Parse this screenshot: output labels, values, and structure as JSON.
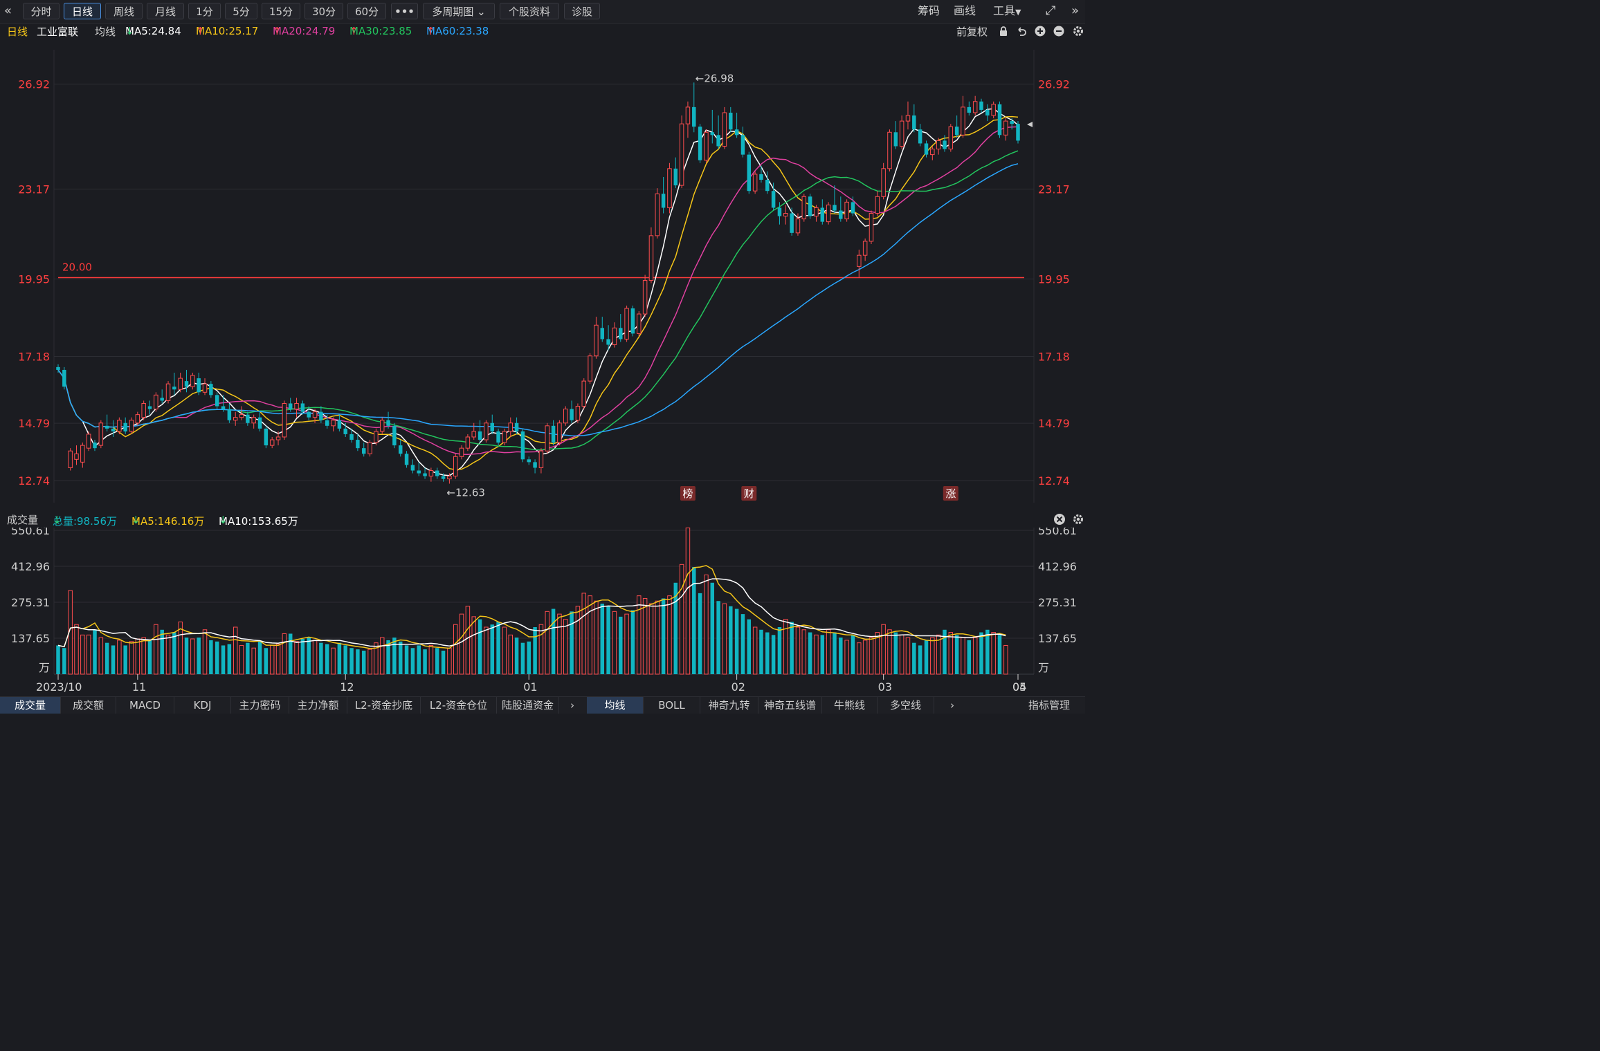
{
  "toolbar": {
    "back_icon": "double-chevron-left-icon",
    "periods": [
      "分时",
      "日线",
      "周线",
      "月线",
      "1分",
      "5分",
      "15分",
      "30分",
      "60分"
    ],
    "active_period": "日线",
    "more_label": "•••",
    "multi_period_label": "多周期图",
    "stock_info_label": "个股资料",
    "diagnose_label": "诊股",
    "right_items": [
      "筹码",
      "画线",
      "工具"
    ],
    "expand_icon": "expand-icon",
    "collapse_icon": "double-chevron-right-icon"
  },
  "price_header": {
    "period": "日线",
    "stock_name": "工业富联",
    "ma_label": "均线",
    "ma": [
      {
        "label": "MA5:24.84",
        "arrow": "↓",
        "color": "#ffffff",
        "arrow_color": "#2ecc71"
      },
      {
        "label": "MA10:25.17",
        "arrow": "↑",
        "color": "#f5c518",
        "arrow_color": "#ff4d4f"
      },
      {
        "label": "MA20:24.79",
        "arrow": "↑",
        "color": "#e040a0",
        "arrow_color": "#ff4d4f"
      },
      {
        "label": "MA30:23.85",
        "arrow": "↑",
        "color": "#22c55e",
        "arrow_color": "#ff4d4f"
      },
      {
        "label": "MA60:23.38",
        "arrow": "↑",
        "color": "#2aa7ff",
        "arrow_color": "#ff4d4f"
      }
    ],
    "adjust_label": "前复权"
  },
  "volume_header": {
    "title": "成交量",
    "total": "总量:98.56万",
    "total_arrow": "↓",
    "ma5": "MA5:146.16万",
    "ma5_arrow": "↓",
    "ma10": "MA10:153.65万",
    "ma10_arrow": "↓"
  },
  "colors": {
    "up": "#ff4d4f",
    "down": "#11b5c2",
    "ma5": "#ffffff",
    "ma10": "#f5c518",
    "ma20": "#e040a0",
    "ma30": "#22c55e",
    "ma60": "#2aa7ff",
    "axis_text": "#ff4040",
    "grid": "#2c2d33"
  },
  "chart_data": [
    {
      "type": "candlestick",
      "ylim": [
        11.95,
        28.15
      ],
      "y_ticks": [
        "26.92",
        "23.17",
        "19.95",
        "17.18",
        "14.79",
        "12.74"
      ],
      "x_ticks": [
        "2023/10",
        "11",
        "12",
        "01",
        "02",
        "03",
        "04",
        "05"
      ],
      "reference_line": {
        "value": 20.0,
        "label": "20.00"
      },
      "annotations": [
        {
          "label": "←26.98",
          "value": 26.98
        },
        {
          "label": "←12.63",
          "value": 12.63
        }
      ],
      "event_markers": [
        "榜",
        "财",
        "涨"
      ],
      "ohlc": [
        [
          16.8,
          16.9,
          16.6,
          16.7
        ],
        [
          16.7,
          16.8,
          16.0,
          16.1
        ],
        [
          13.2,
          13.9,
          13.1,
          13.8
        ],
        [
          13.5,
          14.0,
          13.3,
          13.7
        ],
        [
          13.4,
          14.1,
          13.2,
          14.0
        ],
        [
          13.9,
          14.5,
          13.8,
          14.4
        ],
        [
          14.1,
          14.2,
          13.8,
          13.9
        ],
        [
          14.0,
          14.9,
          13.9,
          14.8
        ],
        [
          14.7,
          15.1,
          14.5,
          14.6
        ],
        [
          14.6,
          14.9,
          14.3,
          14.5
        ],
        [
          14.5,
          15.0,
          14.4,
          14.9
        ],
        [
          14.8,
          15.0,
          14.4,
          14.5
        ],
        [
          14.5,
          15.0,
          14.4,
          14.9
        ],
        [
          14.8,
          15.2,
          14.7,
          15.1
        ],
        [
          15.0,
          15.6,
          14.9,
          15.5
        ],
        [
          15.4,
          15.6,
          15.1,
          15.3
        ],
        [
          15.3,
          15.9,
          15.2,
          15.8
        ],
        [
          15.7,
          16.0,
          15.5,
          15.6
        ],
        [
          15.6,
          16.3,
          15.5,
          16.2
        ],
        [
          16.1,
          16.6,
          15.8,
          16.0
        ],
        [
          16.0,
          16.6,
          15.9,
          16.4
        ],
        [
          16.3,
          16.7,
          15.9,
          16.1
        ],
        [
          16.1,
          16.6,
          16.0,
          16.5
        ],
        [
          16.4,
          16.6,
          15.8,
          15.9
        ],
        [
          15.9,
          16.4,
          15.8,
          16.2
        ],
        [
          16.2,
          16.3,
          15.7,
          15.8
        ],
        [
          15.8,
          15.9,
          15.3,
          15.4
        ],
        [
          15.4,
          15.8,
          15.2,
          15.3
        ],
        [
          15.3,
          15.5,
          14.8,
          14.9
        ],
        [
          14.9,
          15.2,
          14.7,
          15.0
        ],
        [
          15.0,
          15.4,
          14.9,
          15.1
        ],
        [
          15.1,
          15.2,
          14.7,
          14.8
        ],
        [
          14.8,
          15.1,
          14.6,
          15.0
        ],
        [
          15.0,
          15.2,
          14.5,
          14.6
        ],
        [
          14.6,
          14.7,
          13.9,
          14.0
        ],
        [
          14.0,
          14.3,
          13.9,
          14.2
        ],
        [
          14.2,
          14.5,
          14.0,
          14.3
        ],
        [
          14.3,
          15.6,
          14.2,
          15.5
        ],
        [
          15.5,
          15.7,
          15.2,
          15.3
        ],
        [
          15.3,
          15.7,
          15.0,
          15.5
        ],
        [
          15.5,
          15.6,
          15.1,
          15.2
        ],
        [
          15.2,
          15.4,
          14.9,
          15.0
        ],
        [
          15.0,
          15.3,
          14.8,
          15.2
        ],
        [
          15.2,
          15.4,
          14.8,
          14.9
        ],
        [
          14.9,
          15.1,
          14.6,
          14.7
        ],
        [
          14.7,
          15.0,
          14.5,
          14.9
        ],
        [
          14.9,
          15.1,
          14.5,
          14.6
        ],
        [
          14.6,
          14.8,
          14.3,
          14.4
        ],
        [
          14.4,
          14.6,
          14.1,
          14.2
        ],
        [
          14.2,
          14.4,
          13.8,
          13.9
        ],
        [
          13.9,
          14.1,
          13.6,
          13.7
        ],
        [
          13.7,
          14.2,
          13.6,
          14.1
        ],
        [
          14.1,
          14.6,
          14.0,
          14.5
        ],
        [
          14.5,
          15.0,
          14.4,
          14.9
        ],
        [
          14.9,
          15.2,
          14.6,
          14.7
        ],
        [
          14.7,
          14.8,
          13.9,
          14.0
        ],
        [
          14.0,
          14.2,
          13.6,
          13.7
        ],
        [
          13.7,
          13.8,
          13.2,
          13.3
        ],
        [
          13.3,
          13.5,
          13.0,
          13.1
        ],
        [
          13.1,
          13.4,
          12.9,
          13.0
        ],
        [
          13.0,
          13.2,
          12.8,
          12.9
        ],
        [
          12.9,
          13.2,
          12.7,
          13.1
        ],
        [
          13.1,
          13.2,
          12.8,
          12.9
        ],
        [
          12.9,
          13.0,
          12.7,
          12.8
        ],
        [
          12.8,
          13.0,
          12.63,
          12.9
        ],
        [
          12.9,
          13.7,
          12.8,
          13.6
        ],
        [
          13.6,
          14.0,
          13.5,
          13.9
        ],
        [
          13.9,
          14.4,
          13.8,
          14.3
        ],
        [
          14.3,
          14.8,
          14.2,
          14.5
        ],
        [
          14.5,
          14.9,
          14.1,
          14.2
        ],
        [
          14.2,
          14.9,
          14.1,
          14.8
        ],
        [
          14.8,
          15.1,
          14.4,
          14.5
        ],
        [
          14.5,
          14.6,
          14.0,
          14.1
        ],
        [
          14.1,
          14.6,
          14.0,
          14.5
        ],
        [
          14.5,
          15.0,
          14.3,
          14.8
        ],
        [
          14.8,
          15.0,
          14.4,
          14.5
        ],
        [
          14.5,
          14.6,
          13.4,
          13.5
        ],
        [
          13.5,
          13.6,
          13.3,
          13.4
        ],
        [
          13.4,
          13.5,
          13.0,
          13.2
        ],
        [
          13.2,
          13.9,
          13.0,
          13.8
        ],
        [
          13.8,
          14.8,
          13.7,
          14.7
        ],
        [
          14.7,
          14.9,
          14.0,
          14.1
        ],
        [
          14.1,
          14.9,
          14.0,
          14.8
        ],
        [
          14.8,
          15.4,
          14.7,
          15.3
        ],
        [
          15.3,
          15.6,
          14.8,
          14.9
        ],
        [
          14.9,
          15.5,
          14.8,
          15.4
        ],
        [
          15.4,
          16.4,
          15.3,
          16.3
        ],
        [
          16.3,
          17.3,
          16.2,
          17.2
        ],
        [
          17.2,
          18.6,
          17.1,
          18.3
        ],
        [
          18.2,
          18.6,
          17.7,
          17.8
        ],
        [
          17.8,
          18.3,
          17.4,
          17.6
        ],
        [
          17.6,
          18.4,
          17.5,
          18.2
        ],
        [
          18.2,
          18.7,
          17.7,
          17.8
        ],
        [
          17.8,
          19.0,
          17.7,
          18.9
        ],
        [
          18.9,
          19.0,
          17.9,
          18.0
        ],
        [
          18.0,
          18.8,
          17.9,
          18.7
        ],
        [
          18.7,
          20.1,
          18.6,
          19.9
        ],
        [
          19.9,
          21.8,
          19.8,
          21.5
        ],
        [
          21.5,
          23.2,
          21.4,
          23.0
        ],
        [
          23.0,
          23.6,
          22.3,
          22.5
        ],
        [
          22.5,
          24.1,
          22.3,
          23.9
        ],
        [
          23.9,
          24.3,
          23.2,
          23.3
        ],
        [
          23.3,
          25.8,
          23.2,
          25.5
        ],
        [
          25.5,
          26.3,
          25.0,
          26.1
        ],
        [
          26.1,
          26.98,
          25.2,
          25.4
        ],
        [
          25.4,
          25.5,
          24.1,
          24.2
        ],
        [
          24.2,
          25.3,
          24.1,
          25.2
        ],
        [
          25.2,
          26.0,
          24.8,
          25.1
        ],
        [
          25.1,
          25.8,
          24.6,
          24.7
        ],
        [
          24.7,
          26.1,
          24.6,
          25.9
        ],
        [
          25.9,
          26.1,
          25.2,
          25.3
        ],
        [
          25.3,
          25.9,
          25.0,
          25.1
        ],
        [
          25.1,
          25.4,
          24.3,
          24.4
        ],
        [
          24.4,
          24.5,
          23.0,
          23.1
        ],
        [
          23.1,
          23.8,
          23.0,
          23.7
        ],
        [
          23.7,
          24.0,
          23.4,
          23.5
        ],
        [
          23.5,
          23.8,
          23.0,
          23.1
        ],
        [
          23.1,
          23.4,
          22.4,
          22.5
        ],
        [
          22.5,
          22.7,
          21.9,
          22.2
        ],
        [
          22.2,
          22.6,
          21.9,
          22.3
        ],
        [
          22.3,
          22.5,
          21.5,
          21.6
        ],
        [
          21.6,
          22.3,
          21.5,
          22.1
        ],
        [
          22.1,
          23.0,
          22.0,
          22.9
        ],
        [
          22.9,
          23.0,
          22.1,
          22.2
        ],
        [
          22.2,
          22.6,
          22.0,
          22.5
        ],
        [
          22.5,
          22.8,
          21.9,
          22.0
        ],
        [
          22.0,
          22.7,
          21.9,
          22.6
        ],
        [
          22.6,
          23.3,
          22.3,
          22.4
        ],
        [
          22.4,
          22.9,
          22.0,
          22.1
        ],
        [
          22.1,
          22.8,
          22.0,
          22.7
        ],
        [
          22.7,
          22.9,
          22.2,
          22.3
        ],
        [
          20.4,
          21.0,
          20.0,
          20.8
        ],
        [
          20.8,
          21.4,
          20.6,
          21.3
        ],
        [
          21.3,
          22.4,
          21.2,
          22.3
        ],
        [
          22.3,
          23.1,
          22.2,
          22.9
        ],
        [
          22.9,
          24.1,
          22.8,
          23.9
        ],
        [
          23.9,
          25.3,
          23.8,
          25.2
        ],
        [
          25.2,
          25.6,
          24.6,
          24.7
        ],
        [
          24.7,
          25.8,
          24.6,
          25.6
        ],
        [
          25.6,
          26.3,
          25.3,
          25.8
        ],
        [
          25.8,
          26.2,
          25.2,
          25.3
        ],
        [
          25.3,
          25.5,
          24.7,
          24.8
        ],
        [
          24.8,
          24.9,
          24.3,
          24.4
        ],
        [
          24.4,
          24.7,
          24.2,
          24.6
        ],
        [
          24.6,
          25.0,
          24.4,
          24.9
        ],
        [
          24.9,
          25.1,
          24.5,
          24.6
        ],
        [
          24.6,
          25.5,
          24.5,
          25.4
        ],
        [
          25.4,
          25.8,
          25.0,
          25.1
        ],
        [
          25.1,
          26.5,
          25.0,
          26.1
        ],
        [
          26.1,
          26.3,
          25.8,
          25.9
        ],
        [
          25.9,
          26.5,
          25.8,
          26.3
        ],
        [
          26.3,
          26.4,
          25.9,
          26.0
        ],
        [
          26.0,
          26.2,
          25.6,
          25.8
        ],
        [
          25.8,
          26.3,
          25.7,
          26.2
        ],
        [
          26.2,
          26.3,
          25.0,
          25.1
        ],
        [
          25.1,
          25.7,
          24.9,
          25.6
        ],
        [
          25.6,
          25.7,
          25.3,
          25.5
        ],
        [
          25.5,
          25.6,
          24.8,
          24.9
        ]
      ]
    },
    {
      "type": "bar",
      "title": "成交量",
      "y_ticks": [
        "550.61",
        "412.96",
        "275.31",
        "137.65"
      ],
      "y_unit": "万",
      "ylim": [
        0,
        550.61
      ],
      "values": [
        110,
        100,
        320,
        190,
        150,
        150,
        170,
        140,
        120,
        110,
        130,
        110,
        125,
        135,
        140,
        130,
        190,
        170,
        150,
        160,
        200,
        140,
        135,
        140,
        170,
        130,
        125,
        110,
        115,
        180,
        110,
        120,
        100,
        125,
        100,
        110,
        115,
        155,
        155,
        125,
        135,
        140,
        130,
        120,
        115,
        100,
        120,
        110,
        100,
        95,
        90,
        95,
        120,
        140,
        130,
        140,
        125,
        110,
        100,
        110,
        95,
        110,
        100,
        90,
        100,
        190,
        230,
        260,
        220,
        210,
        180,
        190,
        200,
        180,
        150,
        140,
        120,
        125,
        180,
        190,
        240,
        250,
        230,
        210,
        240,
        260,
        310,
        300,
        280,
        270,
        260,
        240,
        220,
        230,
        245,
        300,
        290,
        270,
        280,
        290,
        300,
        350,
        420,
        560,
        410,
        310,
        380,
        350,
        280,
        270,
        260,
        250,
        230,
        210,
        180,
        170,
        160,
        150,
        180,
        210,
        200,
        180,
        170,
        160,
        150,
        150,
        170,
        160,
        140,
        130,
        150,
        120,
        130,
        140,
        160,
        190,
        170,
        160,
        150,
        140,
        120,
        110,
        130,
        140,
        150,
        170,
        160,
        150,
        140,
        130,
        140,
        160,
        170,
        160,
        150,
        110
      ]
    }
  ],
  "bottom_tabs_left": [
    "成交量",
    "成交额",
    "MACD",
    "KDJ",
    "主力密码",
    "主力净额",
    "L2-资金抄底",
    "L2-资金仓位",
    "陆股通资金"
  ],
  "bottom_tabs_right": [
    "均线",
    "BOLL",
    "神奇九转",
    "神奇五线谱",
    "牛熊线",
    "多空线"
  ],
  "indicator_manage_label": "指标管理"
}
